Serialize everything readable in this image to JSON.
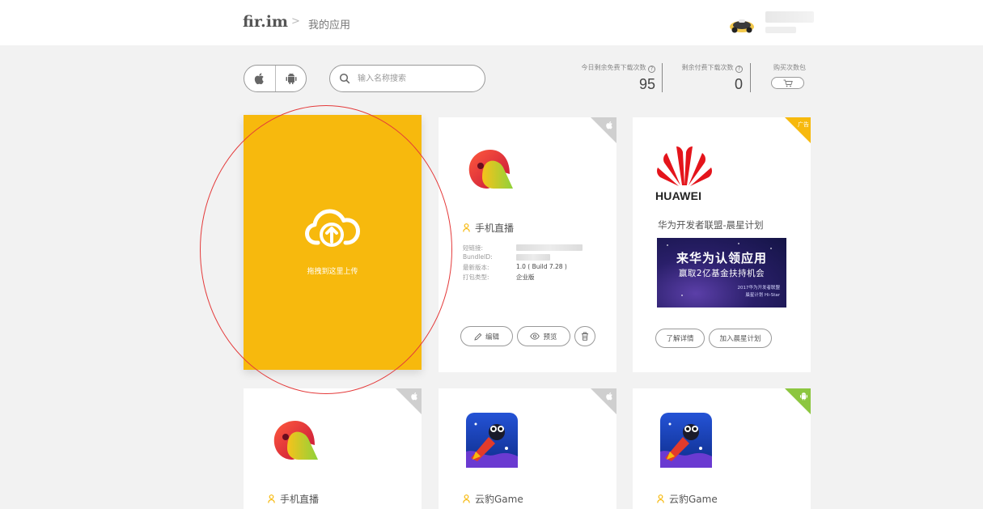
{
  "header": {
    "brand": "fir.im",
    "separator": ">",
    "breadcrumb": "我的应用"
  },
  "toolbar": {
    "search_placeholder": "输入名称搜索",
    "stats": [
      {
        "label": "今日剩余免费下载次数",
        "value": "95"
      },
      {
        "label": "剩余付费下载次数",
        "value": "0"
      }
    ],
    "buy_label": "购买次数包"
  },
  "upload_card": {
    "label": "拖拽到这里上传"
  },
  "app_card_1": {
    "name": "手机直播",
    "fields": [
      {
        "key": "短链接:",
        "value": ""
      },
      {
        "key": "BundleID:",
        "value": ""
      },
      {
        "key": "最新版本:",
        "value": "1.0 ( Build 7.28 )"
      },
      {
        "key": "打包类型:",
        "value": "企业版"
      }
    ],
    "edit_label": "编辑",
    "preview_label": "预览"
  },
  "ad_card": {
    "badge": "广告",
    "logo_text": "HUAWEI",
    "title": "华为开发者联盟-晨星计划",
    "banner_line1": "来华为认领应用",
    "banner_line2": "赢取2亿基金扶持机会",
    "banner_line3": "2017华为开发者联盟",
    "banner_line4": "晨星计划 Hi-Star",
    "learn_more": "了解详情",
    "join": "加入晨星计划"
  },
  "bottom_cards": [
    {
      "name": "手机直播",
      "platform": "ios"
    },
    {
      "name": "云豹Game",
      "platform": "ios"
    },
    {
      "name": "云豹Game",
      "platform": "android"
    }
  ],
  "colors": {
    "accent": "#f7b90d",
    "android": "#8cc63f",
    "ios_corner": "#cfcfcf"
  }
}
